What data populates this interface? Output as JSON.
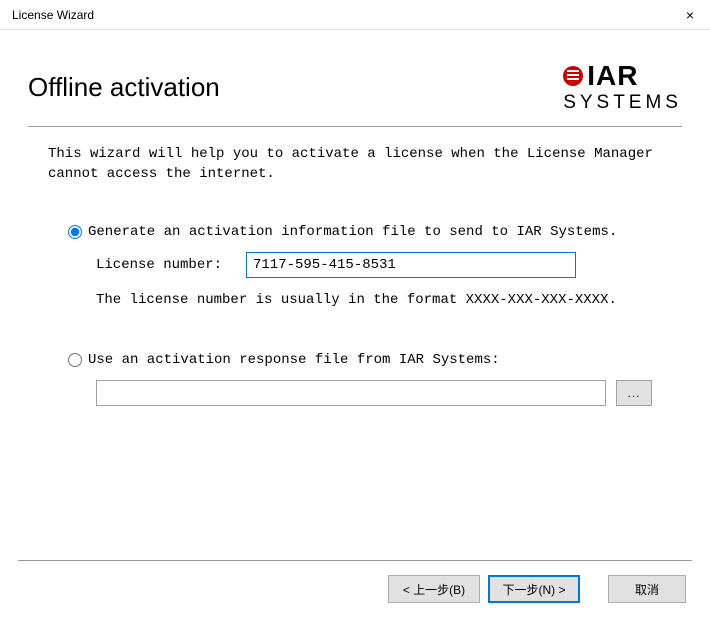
{
  "window": {
    "title": "License Wizard",
    "close": "×"
  },
  "header": {
    "heading": "Offline activation",
    "logo_iar": "IAR",
    "logo_systems": "SYSTEMS"
  },
  "intro": "This wizard will help you to activate a license when the License Manager cannot access the internet.",
  "options": {
    "generate": {
      "label": "Generate an activation information file to send to IAR Systems.",
      "license_label": "License number:",
      "license_value": "7117-595-415-8531",
      "format_hint": "The license number is usually in the format XXXX-XXX-XXX-XXXX."
    },
    "response": {
      "label": "Use an activation response file from IAR Systems:",
      "file_value": "",
      "browse": "..."
    }
  },
  "buttons": {
    "back": "< 上一步(B)",
    "next": "下一步(N) >",
    "cancel": "取消"
  }
}
